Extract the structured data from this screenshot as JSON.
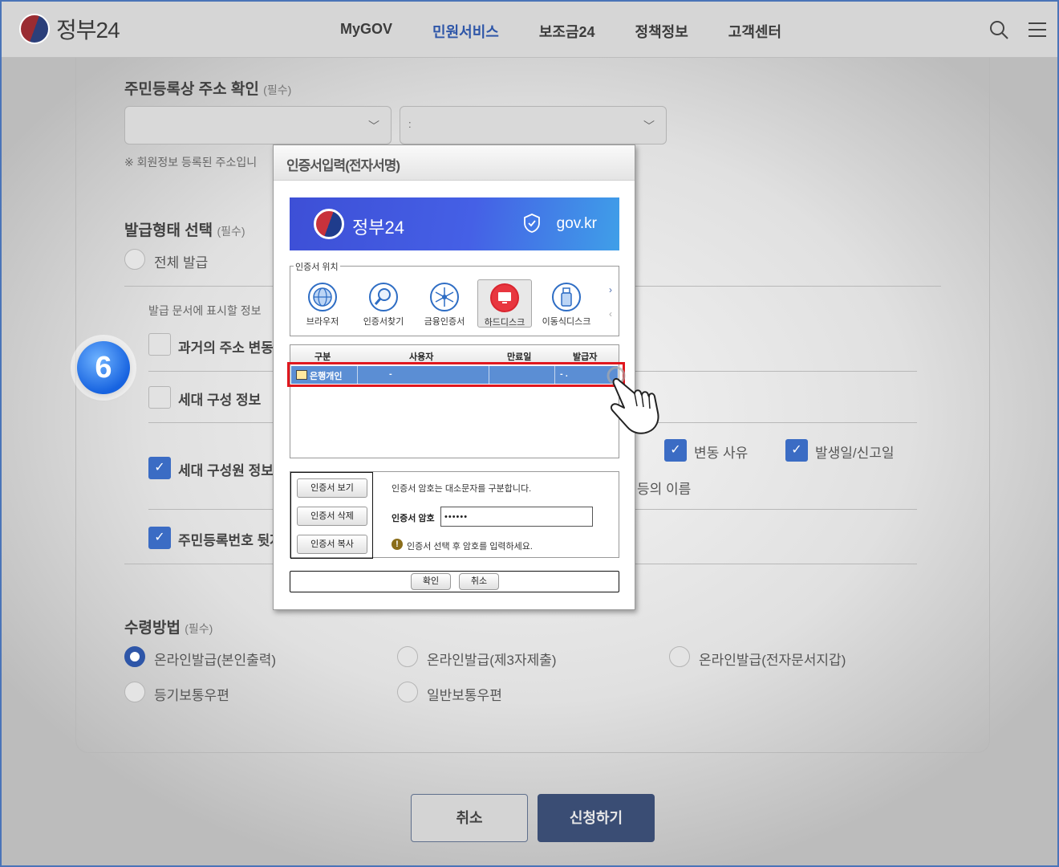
{
  "header": {
    "logo_text": "정부24",
    "nav": [
      "MyGOV",
      "민원서비스",
      "보조금24",
      "정책정보",
      "고객센터"
    ],
    "active_nav": "민원서비스",
    "search_icon": "search-icon",
    "menu_icon": "menu-icon"
  },
  "address": {
    "title": "주민등록상 주소 확인",
    "required": "(필수)",
    "select1_value": "",
    "select2_value": ":",
    "note": "※ 회원정보 등록된 주소입니"
  },
  "issue_type": {
    "title": "발급형태 선택",
    "required": "(필수)",
    "option_all": "전체 발급",
    "sub_note": "발급 문서에 표시할 정보",
    "opt_past_address": "과거의 주소 변동사",
    "opt_household": "세대 구성 정보",
    "opt_members": "세대 구성원 정보",
    "opt_rrn": "주민등록번호 뒷자",
    "opt_change_reason": "변동 사유",
    "opt_date": "발생일/신고일",
    "opt_name_fragment": "등의 이름"
  },
  "receive": {
    "title": "수령방법",
    "required": "(필수)",
    "opt1": "온라인발급(본인출력)",
    "opt2": "온라인발급(제3자제출)",
    "opt3": "온라인발급(전자문서지갑)",
    "opt4": "등기보통우편",
    "opt5": "일반보통우편"
  },
  "bottom": {
    "cancel": "취소",
    "submit": "신청하기"
  },
  "step_badge": "6",
  "dialog": {
    "title": "인증서입력(전자서명)",
    "banner_title": "정부24",
    "banner_domain": "gov.kr",
    "location_legend": "인증서 위치",
    "locations": [
      "브라우저",
      "인증서찾기",
      "금융인증서",
      "하드디스크",
      "이동식디스크"
    ],
    "selected_location": "하드디스크",
    "columns": [
      "구분",
      "사용자",
      "만료일",
      "발급자"
    ],
    "row": {
      "type": "은행개인",
      "user": "-",
      "expiry": "",
      "issuer": "- ."
    },
    "btn_view": "인증서 보기",
    "btn_delete": "인증서 삭제",
    "btn_copy": "인증서 복사",
    "case_note": "인증서 암호는 대소문자를 구분합니다.",
    "pw_label": "인증서 암호",
    "pw_value": "••••••",
    "warning": "인증서 선택 후 암호를 입력하세요.",
    "ok": "확인",
    "cancel": "취소"
  },
  "colors": {
    "accent": "#2e56a8",
    "highlight": "#e0171e",
    "step_badge": "#1763e0"
  }
}
